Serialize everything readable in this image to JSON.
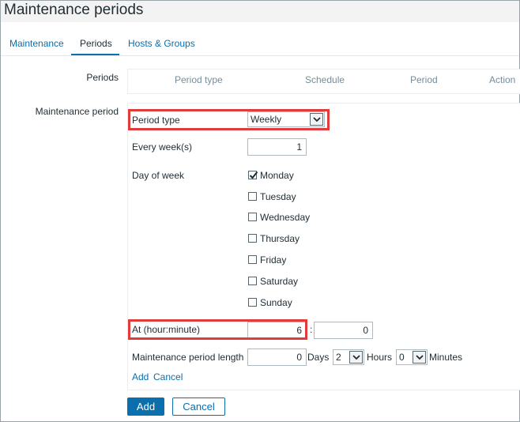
{
  "page": {
    "title": "Maintenance periods"
  },
  "tabs": [
    {
      "label": "Maintenance",
      "active": false
    },
    {
      "label": "Periods",
      "active": true
    },
    {
      "label": "Hosts & Groups",
      "active": false
    }
  ],
  "periods": {
    "label": "Periods",
    "columns": [
      "Period type",
      "Schedule",
      "Period",
      "Action"
    ]
  },
  "maintenance_period": {
    "label": "Maintenance period",
    "period_type": {
      "label": "Period type",
      "value": "Weekly"
    },
    "every_weeks": {
      "label": "Every week(s)",
      "value": "1"
    },
    "day_of_week": {
      "label": "Day of week",
      "days": [
        {
          "label": "Monday",
          "checked": true
        },
        {
          "label": "Tuesday",
          "checked": false
        },
        {
          "label": "Wednesday",
          "checked": false
        },
        {
          "label": "Thursday",
          "checked": false
        },
        {
          "label": "Friday",
          "checked": false
        },
        {
          "label": "Saturday",
          "checked": false
        },
        {
          "label": "Sunday",
          "checked": false
        }
      ]
    },
    "at": {
      "label": "At (hour:minute)",
      "hour": "6",
      "separator": ":",
      "minute": "0"
    },
    "length": {
      "label": "Maintenance period length",
      "days_value": "0",
      "days_label": "Days",
      "hours_value": "2",
      "hours_label": "Hours",
      "minutes_value": "0",
      "minutes_label": "Minutes"
    },
    "links": {
      "add": "Add",
      "cancel": "Cancel"
    }
  },
  "buttons": {
    "add": "Add",
    "cancel": "Cancel"
  },
  "colors": {
    "accent": "#0b6ead",
    "highlight": "#e03c3c",
    "muted": "#768d99"
  }
}
